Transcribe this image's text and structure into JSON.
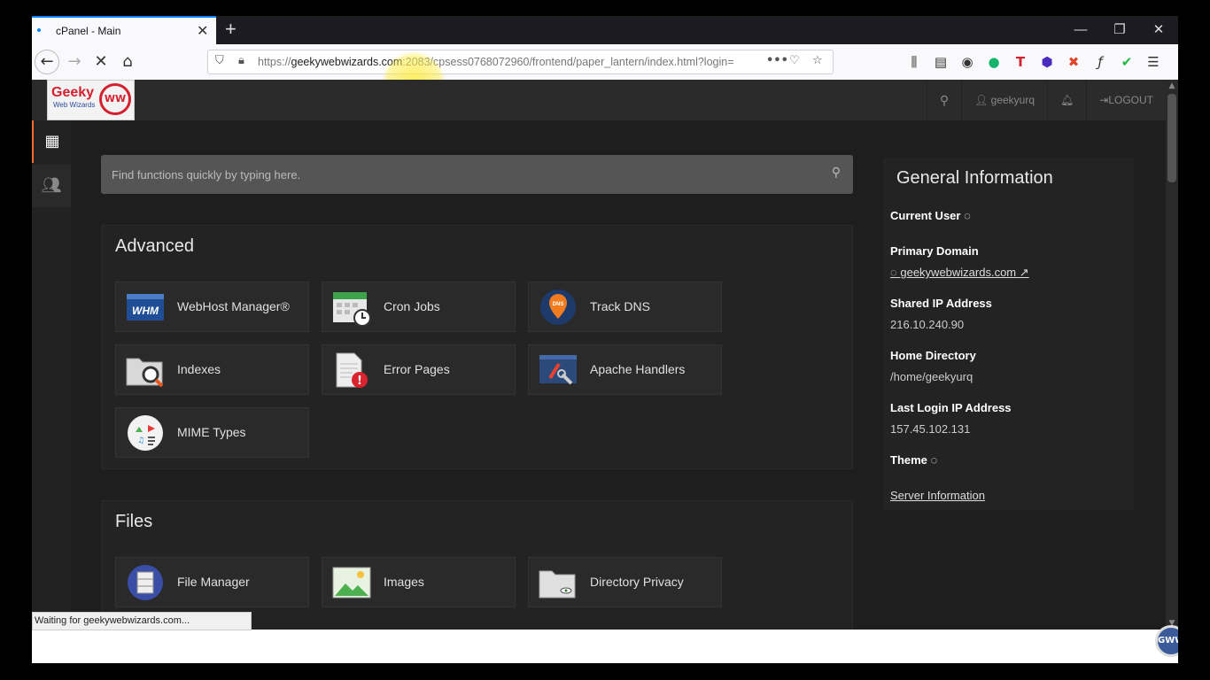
{
  "browser": {
    "tab_title": "cPanel - Main",
    "url_host": "geekywebwizards.com",
    "url_prefix": "https://",
    "url_rest": ":2083/cpsess0768072960/frontend/paper_lantern/index.html?login=",
    "status_text": "Waiting for geekywebwizards.com..."
  },
  "header": {
    "logo_text": "Geeky",
    "logo_sub": "Web Wizards",
    "logo_mark": "WW",
    "username": "geekyurq",
    "logout_label": "LOGOUT"
  },
  "search": {
    "placeholder": "Find functions quickly by typing here."
  },
  "advanced": {
    "title": "Advanced",
    "items": [
      {
        "label": "WebHost Manager®",
        "icon_text": "WHM"
      },
      {
        "label": "Cron Jobs"
      },
      {
        "label": "Track DNS",
        "icon_text": "DNS"
      },
      {
        "label": "Indexes"
      },
      {
        "label": "Error Pages"
      },
      {
        "label": "Apache Handlers"
      },
      {
        "label": "MIME Types"
      }
    ]
  },
  "files": {
    "title": "Files",
    "items": [
      {
        "label": "File Manager"
      },
      {
        "label": "Images"
      },
      {
        "label": "Directory Privacy"
      }
    ]
  },
  "general_info": {
    "title": "General Information",
    "current_user_label": "Current User",
    "primary_domain_label": "Primary Domain",
    "primary_domain_value": "geekywebwizards.com",
    "shared_ip_label": "Shared IP Address",
    "shared_ip_value": "216.10.240.90",
    "home_dir_label": "Home Directory",
    "home_dir_value": "/home/geekyurq",
    "last_login_label": "Last Login IP Address",
    "last_login_value": "157.45.102.131",
    "theme_label": "Theme",
    "server_info_link": "Server Information"
  },
  "watermark": "GWW",
  "colors": {
    "accent": "#ff6c2c",
    "panel_bg": "#232323",
    "tab_accent": "#0a84ff"
  }
}
